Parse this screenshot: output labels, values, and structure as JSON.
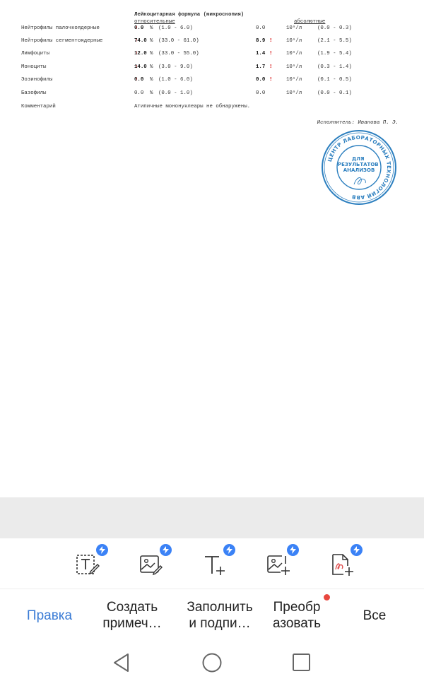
{
  "document": {
    "section_title": "Лейкоцитарная формула (микроскопия)",
    "header_relative": "относительные",
    "header_absolute": "абсолютные",
    "rows": [
      {
        "name": "Нейтрофилы палочкоядерные",
        "rel": "0.0",
        "unit_rel": "%",
        "ref": "(1.0 - 6.0)",
        "abs": "0.0",
        "unit_abs": "10⁹/л",
        "abs_ref": "(0.0 - 0.3)",
        "flag_rel": "↑",
        "flag_abs": ""
      },
      {
        "name": "Нейтрофилы сегментоядерные",
        "rel": "74.0",
        "unit_rel": "%",
        "ref": "(33.0 - 61.0)",
        "abs": "8.9",
        "unit_abs": "10⁹/л",
        "abs_ref": "(2.1 - 5.5)",
        "flag_rel": "↑",
        "flag_abs": "!"
      },
      {
        "name": "Лимфоциты",
        "rel": "12.0",
        "unit_rel": "%",
        "ref": "(33.0 - 55.0)",
        "abs": "1.4",
        "unit_abs": "10⁹/л",
        "abs_ref": "(1.9 - 5.4)",
        "flag_rel": "↑",
        "flag_abs": "!"
      },
      {
        "name": "Моноциты",
        "rel": "14.0",
        "unit_rel": "%",
        "ref": "(3.0 - 9.0)",
        "abs": "1.7",
        "unit_abs": "10⁹/л",
        "abs_ref": "(0.3 - 1.4)",
        "flag_rel": "↑",
        "flag_abs": "!"
      },
      {
        "name": "Эозинофилы",
        "rel": "0.0",
        "unit_rel": "%",
        "ref": "(1.0 - 6.0)",
        "abs": "0.0",
        "unit_abs": "10⁹/л",
        "abs_ref": "(0.1 - 0.5)",
        "flag_rel": "↑",
        "flag_abs": "!"
      },
      {
        "name": "Базофилы",
        "rel": "0.0",
        "unit_rel": "%",
        "ref": "(0.0 - 1.0)",
        "abs": "0.0",
        "unit_abs": "10⁹/л",
        "abs_ref": "(0.0 - 0.1)",
        "flag_rel": "",
        "flag_abs": ""
      }
    ],
    "comment_label": "Комментарий",
    "comment_text": "Атипичные мононуклеары не обнаружены.",
    "performer": "Исполнитель: Иванова П. Э.",
    "stamp": {
      "center_text": "ДЛЯ\nРЕЗУЛЬТАТОВ\nАНАЛИЗОВ",
      "ring_text": "ЦЕНТР ЛАБОРАТОРНЫХ ТЕХНОЛОГИЙ АВВ",
      "color": "#2c7fbf"
    }
  },
  "tools": [
    {
      "icon": "edit-text-icon"
    },
    {
      "icon": "edit-image-icon"
    },
    {
      "icon": "add-text-icon"
    },
    {
      "icon": "add-image-icon"
    },
    {
      "icon": "add-signature-doc-icon"
    }
  ],
  "tabs": [
    {
      "label": "Правка",
      "active": true
    },
    {
      "label": "Создать\nпримеч…",
      "active": false
    },
    {
      "label": "Заполнить\nи подпи…",
      "active": false
    },
    {
      "label": "Преобр\nазовать",
      "active": false,
      "notification_dot": true
    },
    {
      "label": "Все",
      "active": false
    }
  ],
  "system_nav": {
    "back": "back-icon",
    "home": "home-icon",
    "recents": "recents-icon"
  },
  "colors": {
    "accent": "#3a7bd5",
    "badge": "#3b82f6",
    "alert": "#d40000",
    "dot": "#e8473f",
    "band": "#ebebeb"
  }
}
